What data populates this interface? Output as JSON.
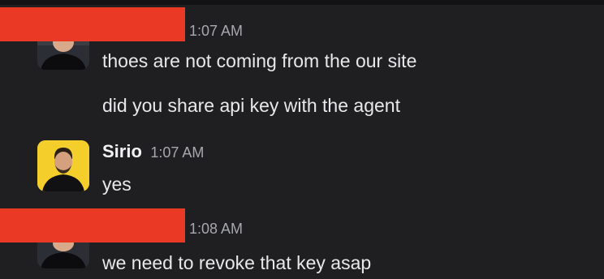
{
  "messages": [
    {
      "sender": "",
      "time": "1:07 AM",
      "lines": [
        "thoes are not coming from the our site",
        "did you share api key with the agent"
      ]
    },
    {
      "sender": "Sirio",
      "time": "1:07 AM",
      "lines": [
        "yes"
      ]
    },
    {
      "sender": "",
      "time": "1:08 AM",
      "lines": [
        "we need to revoke that key asap"
      ]
    }
  ],
  "colors": {
    "background": "#1f1f22",
    "redaction": "#ea3a25",
    "avatar_bg": "#f4cf2b"
  }
}
